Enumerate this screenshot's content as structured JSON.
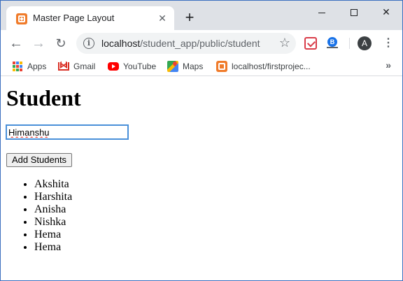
{
  "browser": {
    "tab_title": "Master Page Layout",
    "url_host": "localhost",
    "url_path": "/student_app/public/student",
    "avatar_letter": "A",
    "bookmarks": [
      {
        "label": "Apps"
      },
      {
        "label": "Gmail"
      },
      {
        "label": "YouTube"
      },
      {
        "label": "Maps"
      },
      {
        "label": "localhost/firstprojec..."
      }
    ]
  },
  "page": {
    "title": "Student",
    "input_value": "Himanshu",
    "add_button_label": "Add Students",
    "students": [
      "Akshita",
      "Harshita",
      "Anisha",
      "Nishka",
      "Hema",
      "Hema"
    ]
  },
  "colors": {
    "tabstrip": "#dee1e6",
    "xampp_orange": "#f07b2a",
    "focus_blue": "#4a90d9"
  }
}
